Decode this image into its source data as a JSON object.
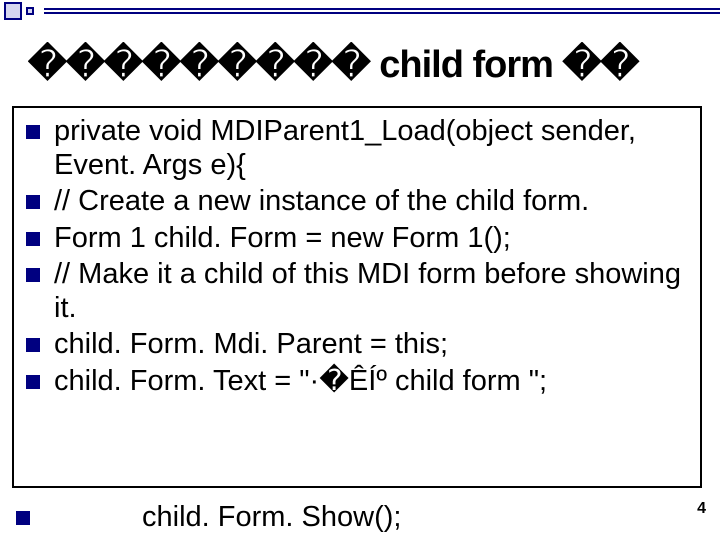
{
  "title": "��������� child form ��",
  "code_lines": [
    " private void MDIParent1_Load(object sender, Event. Args e){",
    "            // Create a new instance of the child form.",
    "            Form 1 child. Form = new Form 1();",
    "            // Make it a child of this MDI form before showing it.",
    "            child. Form. Mdi. Parent = this;",
    "            child. Form. Text = \"·�ÊÍº child form \";"
  ],
  "orphan_line": "child. Form. Show();",
  "page_number": "4"
}
